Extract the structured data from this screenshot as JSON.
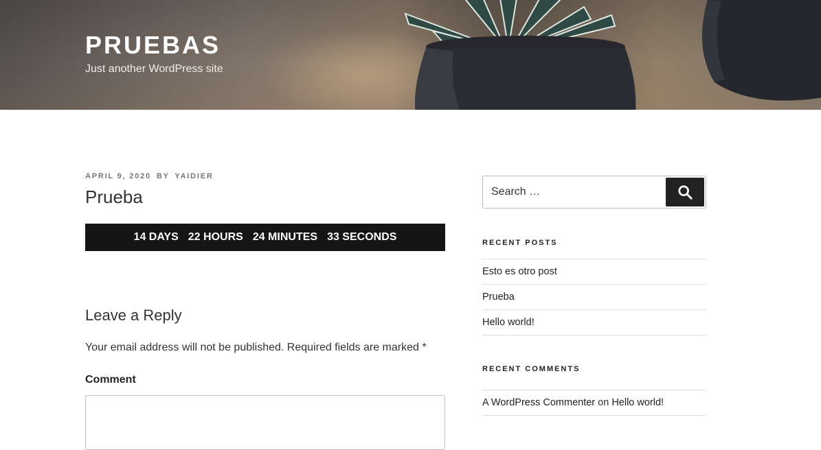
{
  "header": {
    "site_title": "PRUEBAS",
    "site_description": "Just another WordPress site"
  },
  "post": {
    "date": "APRIL 9, 2020",
    "by": "BY",
    "author": "YAIDIER",
    "title": "Prueba"
  },
  "countdown": {
    "days": "14 DAYS",
    "hours": "22 HOURS",
    "minutes": "24 MINUTES",
    "seconds": "33 SECONDS"
  },
  "reply": {
    "title": "Leave a Reply",
    "notes": "Your email address will not be published. Required fields are marked *",
    "comment_label": "Comment"
  },
  "sidebar": {
    "search_placeholder": "Search …",
    "search_icon": "search-icon",
    "recent_posts_title": "RECENT POSTS",
    "recent_posts": [
      "Esto es otro post",
      "Prueba",
      "Hello world!"
    ],
    "recent_comments_title": "RECENT COMMENTS",
    "recent_comments": [
      {
        "author": "A WordPress Commenter",
        "on": "on",
        "post": "Hello world!"
      }
    ]
  },
  "colors": {
    "countdown_bg": "#151515",
    "search_button_bg": "#222222"
  }
}
